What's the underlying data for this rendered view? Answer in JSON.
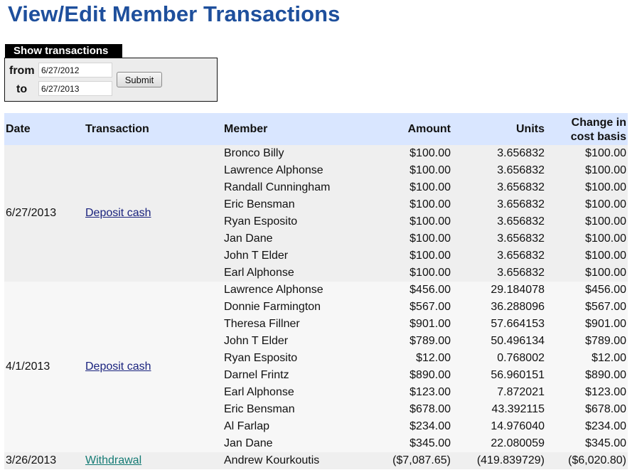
{
  "page": {
    "title": "View/Edit Member Transactions"
  },
  "filter": {
    "legend": "Show transactions",
    "from_label": "from",
    "from_value": "6/27/2012",
    "to_label": "to",
    "to_value": "6/27/2013",
    "submit_label": "Submit"
  },
  "table": {
    "headers": {
      "date": "Date",
      "transaction": "Transaction",
      "member": "Member",
      "amount": "Amount",
      "units": "Units",
      "change_line1": "Change in",
      "change_line2": "cost basis"
    },
    "groups": [
      {
        "date": "6/27/2013",
        "transaction": "Deposit cash",
        "link_color": "#1a237e",
        "rows": [
          {
            "member": "Bronco Billy",
            "amount": "$100.00",
            "units": "3.656832",
            "change": "$100.00"
          },
          {
            "member": "Lawrence Alphonse",
            "amount": "$100.00",
            "units": "3.656832",
            "change": "$100.00"
          },
          {
            "member": "Randall Cunningham",
            "amount": "$100.00",
            "units": "3.656832",
            "change": "$100.00"
          },
          {
            "member": "Eric Bensman",
            "amount": "$100.00",
            "units": "3.656832",
            "change": "$100.00"
          },
          {
            "member": "Ryan Esposito",
            "amount": "$100.00",
            "units": "3.656832",
            "change": "$100.00"
          },
          {
            "member": "Jan Dane",
            "amount": "$100.00",
            "units": "3.656832",
            "change": "$100.00"
          },
          {
            "member": "John T Elder",
            "amount": "$100.00",
            "units": "3.656832",
            "change": "$100.00"
          },
          {
            "member": "Earl Alphonse",
            "amount": "$100.00",
            "units": "3.656832",
            "change": "$100.00"
          }
        ]
      },
      {
        "date": "4/1/2013",
        "transaction": "Deposit cash",
        "link_color": "#1a237e",
        "rows": [
          {
            "member": "Lawrence Alphonse",
            "amount": "$456.00",
            "units": "29.184078",
            "change": "$456.00"
          },
          {
            "member": "Donnie Farmington",
            "amount": "$567.00",
            "units": "36.288096",
            "change": "$567.00"
          },
          {
            "member": "Theresa Fillner",
            "amount": "$901.00",
            "units": "57.664153",
            "change": "$901.00"
          },
          {
            "member": "John T Elder",
            "amount": "$789.00",
            "units": "50.496134",
            "change": "$789.00"
          },
          {
            "member": "Ryan Esposito",
            "amount": "$12.00",
            "units": "0.768002",
            "change": "$12.00"
          },
          {
            "member": "Darnel Frintz",
            "amount": "$890.00",
            "units": "56.960151",
            "change": "$890.00"
          },
          {
            "member": "Earl Alphonse",
            "amount": "$123.00",
            "units": "7.872021",
            "change": "$123.00"
          },
          {
            "member": "Eric Bensman",
            "amount": "$678.00",
            "units": "43.392115",
            "change": "$678.00"
          },
          {
            "member": "Al Farlap",
            "amount": "$234.00",
            "units": "14.976040",
            "change": "$234.00"
          },
          {
            "member": "Jan Dane",
            "amount": "$345.00",
            "units": "22.080059",
            "change": "$345.00"
          }
        ]
      },
      {
        "date": "3/26/2013",
        "transaction": "Withdrawal",
        "link_color": "#147a74",
        "rows": [
          {
            "member": "Andrew Kourkoutis",
            "amount": "($7,087.65)",
            "units": "(419.839729)",
            "change": "($6,020.80)"
          }
        ]
      }
    ]
  }
}
